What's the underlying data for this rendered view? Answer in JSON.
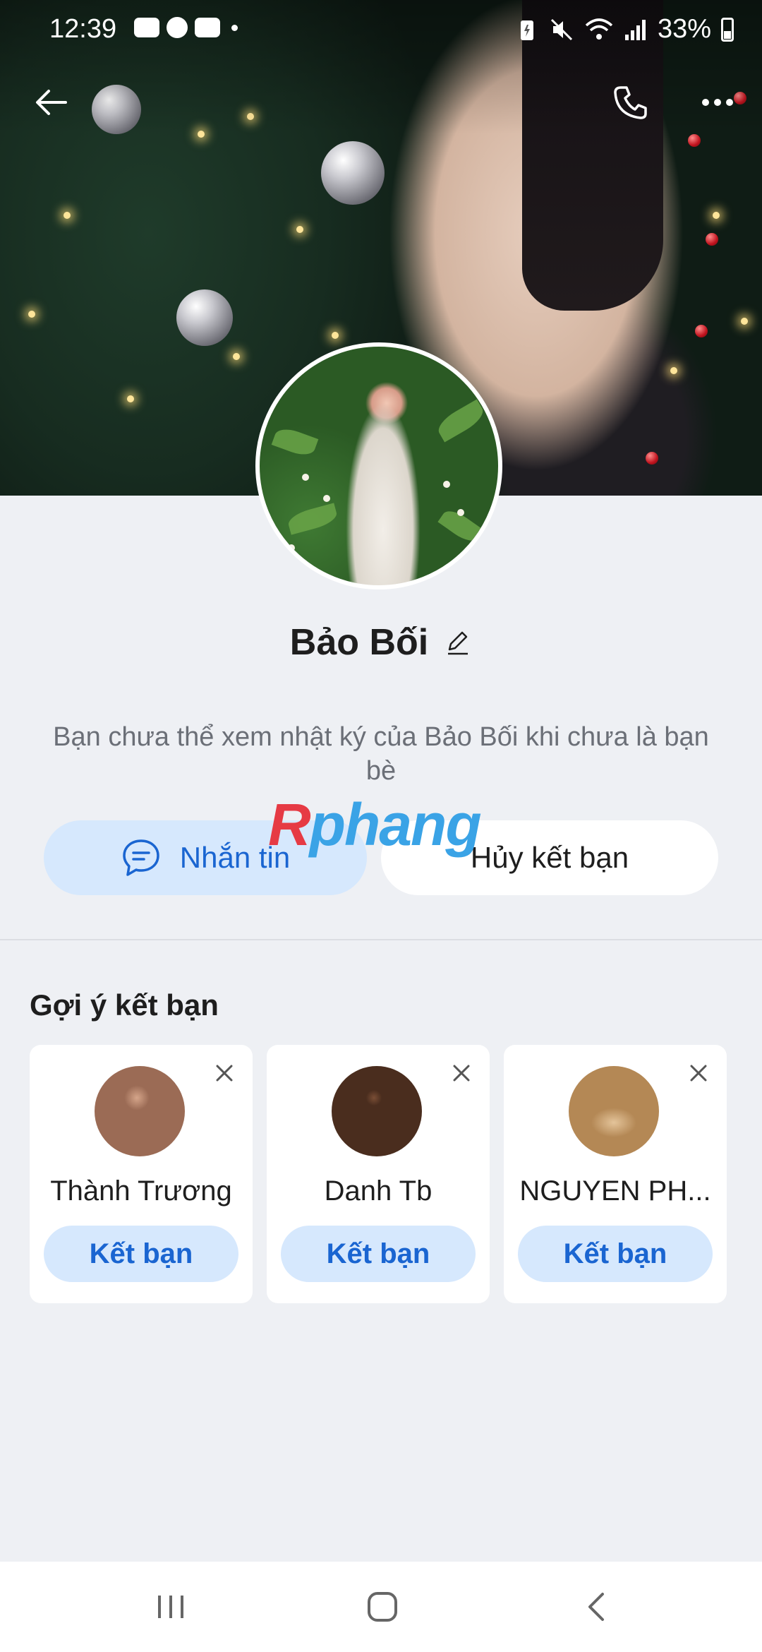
{
  "status_bar": {
    "time": "12:39",
    "battery": "33%"
  },
  "profile": {
    "name": "Bảo Bối",
    "info_text": "Bạn chưa thể xem nhật ký của Bảo Bối khi chưa là bạn bè"
  },
  "actions": {
    "message_label": "Nhắn tin",
    "unfriend_label": "Hủy kết bạn"
  },
  "watermark": {
    "part1": "R",
    "part2": "phang"
  },
  "suggestions": {
    "title": "Gợi ý kết bạn",
    "items": [
      {
        "name": "Thành Trương",
        "button": "Kết bạn"
      },
      {
        "name": "Danh Tb",
        "button": "Kết bạn"
      },
      {
        "name": "NGUYEN PH...",
        "button": "Kết bạn"
      }
    ]
  },
  "colors": {
    "accent": "#1a65d1",
    "accent_bg": "#d6e8fd",
    "page_bg": "#eef0f4"
  },
  "icons": [
    "back-arrow-icon",
    "phone-icon",
    "more-icon",
    "edit-pencil-icon",
    "chat-bubble-icon",
    "close-icon",
    "recent-apps-icon",
    "home-icon",
    "nav-back-icon"
  ]
}
